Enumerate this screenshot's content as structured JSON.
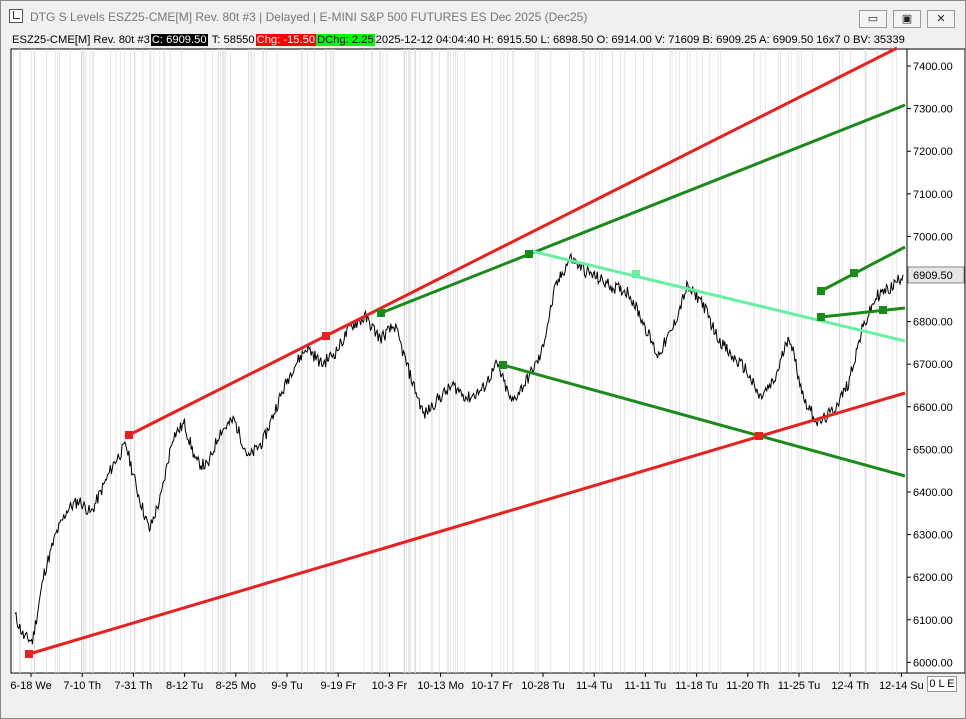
{
  "window": {
    "title": "DTG S Levels ESZ25-CME[M]  Rev. 80t #3 | Delayed | E-MINI S&P 500 FUTURES ES Dec 2025 (Dec25)",
    "minimize_glyph": "▭",
    "maximize_glyph": "▣",
    "close_glyph": "✕"
  },
  "infobar": {
    "symbol": "ESZ25-CME[M]  Rev. 80t #3",
    "close": "C: 6909.50",
    "trades": "T: 58550",
    "change": "Chg: -15.50",
    "dchange": "DChg: 2.25",
    "rest": "2025-12-12 04:04:40 H: 6915.50 L: 6898.50 O: 6914.00 V: 71609 B: 6909.25 A: 6909.50 16x7 0 BV: 35339"
  },
  "bottom_button": "0 L E",
  "colors": {
    "red": "#e8201e",
    "dark_green": "#1a8a1a",
    "light_green": "#66f0a0",
    "price": "#000000",
    "grid": "#d8d8d8"
  },
  "chart_data": {
    "type": "line",
    "title": "",
    "xlabel": "",
    "ylabel": "",
    "ylim": [
      5975,
      7440
    ],
    "y_ticks": [
      6000,
      6100,
      6200,
      6300,
      6400,
      6500,
      6600,
      6700,
      6800,
      6900,
      7000,
      7100,
      7200,
      7300,
      7400
    ],
    "y_tick_labels": [
      "6000.00",
      "6100.00",
      "6200.00",
      "6300.00",
      "6400.00",
      "6500.00",
      "6600.00",
      "6700.00",
      "6800.00",
      "6900.00",
      "7000.00",
      "7100.00",
      "7200.00",
      "7300.00",
      "7400.00"
    ],
    "x_labels": [
      "6-18 We",
      "7-10 Th",
      "7-31 Th",
      "8-12 Tu",
      "8-25 Mo",
      "9-9 Tu",
      "9-19 Fr",
      "10-3 Fr",
      "10-13 Mo",
      "10-17 Fr",
      "10-28 Tu",
      "11-4 Tu",
      "11-11 Tu",
      "11-18 Tu",
      "11-20 Th",
      "11-25 Tu",
      "12-4 Th",
      "12-14 Su"
    ],
    "last_price": 6909.5,
    "last_price_label": "6909.50",
    "price_series": {
      "name": "ESZ25-CME",
      "x_index": [
        0,
        3,
        6,
        10,
        14,
        18,
        22,
        26,
        30,
        34,
        38,
        42,
        46,
        50,
        54,
        58,
        62,
        66,
        70,
        75,
        80,
        85,
        90,
        95,
        100,
        105,
        110,
        115,
        120,
        125,
        130,
        135,
        140,
        145,
        150,
        155,
        160,
        165,
        170,
        175,
        180,
        185,
        190,
        195,
        200,
        205,
        210,
        215,
        220,
        225,
        230,
        235,
        240,
        245,
        250,
        255,
        260,
        265,
        270,
        275,
        280,
        285,
        290,
        295,
        300,
        304
      ],
      "y": [
        6110,
        6060,
        6050,
        6210,
        6300,
        6360,
        6380,
        6350,
        6410,
        6470,
        6510,
        6400,
        6310,
        6390,
        6530,
        6560,
        6470,
        6460,
        6540,
        6570,
        6480,
        6520,
        6610,
        6690,
        6740,
        6700,
        6730,
        6790,
        6810,
        6760,
        6790,
        6680,
        6580,
        6620,
        6650,
        6620,
        6640,
        6700,
        6610,
        6660,
        6720,
        6880,
        6950,
        6920,
        6900,
        6880,
        6870,
        6800,
        6720,
        6780,
        6880,
        6850,
        6770,
        6720,
        6690,
        6620,
        6660,
        6770,
        6620,
        6560,
        6590,
        6650,
        6780,
        6860,
        6880,
        6910
      ]
    },
    "trend_lines": [
      {
        "name": "upper-red",
        "color": "red",
        "points": [
          [
            6.5,
            6527
          ],
          [
            6.8,
            6811
          ],
          [
            7.14,
            7440
          ]
        ],
        "x_units": "date-index"
      },
      {
        "name": "lower-red",
        "color": "red"
      },
      {
        "name": "upper-green",
        "color": "dark_green"
      },
      {
        "name": "middle-green-falling",
        "color": "dark_green"
      },
      {
        "name": "light-green-falling",
        "color": "light_green"
      },
      {
        "name": "short-green-upper",
        "color": "dark_green"
      },
      {
        "name": "short-green-lower",
        "color": "dark_green"
      }
    ],
    "markers": [
      {
        "color": "red",
        "price": 6015
      },
      {
        "color": "red",
        "price": 6527
      },
      {
        "color": "red",
        "price": 6755
      },
      {
        "color": "dark_green",
        "price": 6811
      },
      {
        "color": "dark_green",
        "price": 6950
      },
      {
        "color": "dark_green",
        "price": 6690
      },
      {
        "color": "light_green",
        "price": 6900
      },
      {
        "color": "red",
        "price": 6527
      },
      {
        "color": "dark_green",
        "price": 6862
      },
      {
        "color": "dark_green",
        "price": 6905
      },
      {
        "color": "dark_green",
        "price": 6800
      },
      {
        "color": "dark_green",
        "price": 6817
      }
    ],
    "grid": true,
    "legend": "none"
  }
}
